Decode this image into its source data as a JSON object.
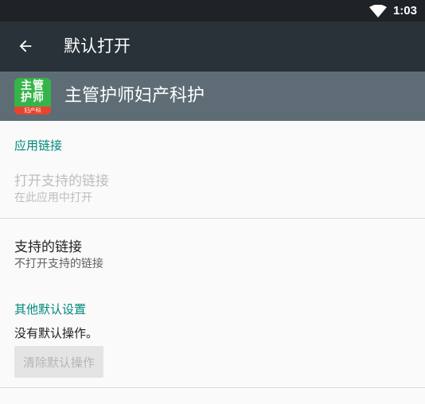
{
  "status_bar": {
    "time": "1:03",
    "icons": [
      "wifi-icon"
    ]
  },
  "toolbar": {
    "back_icon": "back-arrow-icon",
    "title": "默认打开"
  },
  "app_header": {
    "name": "主管护师妇产科护",
    "icon": {
      "text": "主管\n护师",
      "bar_text": "妇产科",
      "bg_color": "#35b44a",
      "bar_color": "#e8442d"
    }
  },
  "app_links": {
    "header": "应用链接",
    "open_supported": {
      "title": "打开支持的链接",
      "subtitle": "在此应用中打开",
      "enabled": false
    },
    "supported_links": {
      "title": "支持的链接",
      "subtitle": "不打开支持的链接"
    }
  },
  "other_defaults": {
    "header": "其他默认设置",
    "status": "没有默认操作。",
    "clear_button": "清除默认操作"
  },
  "colors": {
    "accent": "#00897b",
    "toolbar": "#283238",
    "app_header": "#5e6d75",
    "status_bar": "#1e2328"
  }
}
